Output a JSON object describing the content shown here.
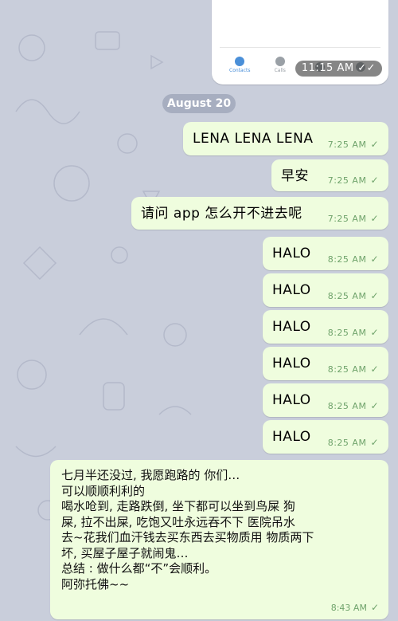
{
  "forwarded_image": {
    "tabs": [
      {
        "label": "Contacts",
        "icon": "person-icon"
      },
      {
        "label": "Calls",
        "icon": "phone-icon"
      },
      {
        "label": "",
        "icon": "chat-icon"
      },
      {
        "label": "",
        "icon": "gear-icon"
      }
    ],
    "time": "11:15 AM",
    "status_icon": "double-check-icon"
  },
  "date_separator": "August 20",
  "messages": [
    {
      "text": "LENA LENA LENA",
      "time": "7:25 AM"
    },
    {
      "text": "早安",
      "time": "7:25 AM"
    },
    {
      "text": "请问 app 怎么开不进去呢",
      "time": "7:25 AM"
    },
    {
      "text": "HALO",
      "time": "8:25 AM"
    },
    {
      "text": "HALO",
      "time": "8:25 AM"
    },
    {
      "text": "HALO",
      "time": "8:25 AM"
    },
    {
      "text": "HALO",
      "time": "8:25 AM"
    },
    {
      "text": "HALO",
      "time": "8:25 AM"
    },
    {
      "text": "HALO",
      "time": "8:25 AM"
    }
  ],
  "long_message": {
    "lines": [
      "七月半还没过, 我愿跑路的 你们…",
      "可以顺顺利利的",
      "喝水呛到, 走路跌倒, 坐下都可以坐到鸟屎 狗",
      "屎, 拉不出屎, 吃饱又吐永远吞不下 医院吊水",
      "去~花我们血汗钱去买东西去买物质用 物质两下",
      "坏, 买屋子屋子就闹鬼…",
      "总结 : 做什么都“不”会顺利。",
      "阿弥托佛~~"
    ],
    "time": "8:43 AM"
  },
  "colors": {
    "background": "#c9cedb",
    "outgoing_bubble": "#effdde",
    "check": "#6fa36b",
    "date_chip": "#a7aec0"
  }
}
